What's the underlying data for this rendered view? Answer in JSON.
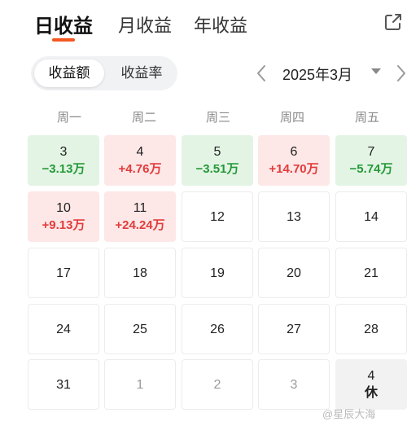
{
  "tabs": [
    {
      "label": "日收益",
      "active": true
    },
    {
      "label": "月收益",
      "active": false
    },
    {
      "label": "年收益",
      "active": false
    }
  ],
  "segment": {
    "options": [
      "收益额",
      "收益率"
    ],
    "selected": "收益额"
  },
  "month_nav": {
    "label": "2025年3月"
  },
  "weekdays": [
    "周一",
    "周二",
    "周三",
    "周四",
    "周五"
  ],
  "calendar": {
    "rows": [
      [
        {
          "day": "3",
          "amount": "−3.13万",
          "trend": "loss"
        },
        {
          "day": "4",
          "amount": "+4.76万",
          "trend": "gain"
        },
        {
          "day": "5",
          "amount": "−3.51万",
          "trend": "loss"
        },
        {
          "day": "6",
          "amount": "+14.70万",
          "trend": "gain"
        },
        {
          "day": "7",
          "amount": "−5.74万",
          "trend": "loss"
        }
      ],
      [
        {
          "day": "10",
          "amount": "+9.13万",
          "trend": "gain"
        },
        {
          "day": "11",
          "amount": "+24.24万",
          "trend": "gain"
        },
        {
          "day": "12"
        },
        {
          "day": "13"
        },
        {
          "day": "14"
        }
      ],
      [
        {
          "day": "17"
        },
        {
          "day": "18"
        },
        {
          "day": "19"
        },
        {
          "day": "20"
        },
        {
          "day": "21"
        }
      ],
      [
        {
          "day": "24"
        },
        {
          "day": "25"
        },
        {
          "day": "26"
        },
        {
          "day": "27"
        },
        {
          "day": "28"
        }
      ],
      [
        {
          "day": "31"
        },
        {
          "day": "1",
          "other_month": true
        },
        {
          "day": "2",
          "other_month": true
        },
        {
          "day": "3",
          "other_month": true
        },
        {
          "day": "4",
          "note": "休"
        }
      ]
    ]
  },
  "watermark": "@星辰大海",
  "colors": {
    "accent": "#f2581f",
    "gain": "#e23b3b",
    "loss": "#259a3a",
    "gain_bg": "#fde7e7",
    "loss_bg": "#e3f4e4"
  }
}
